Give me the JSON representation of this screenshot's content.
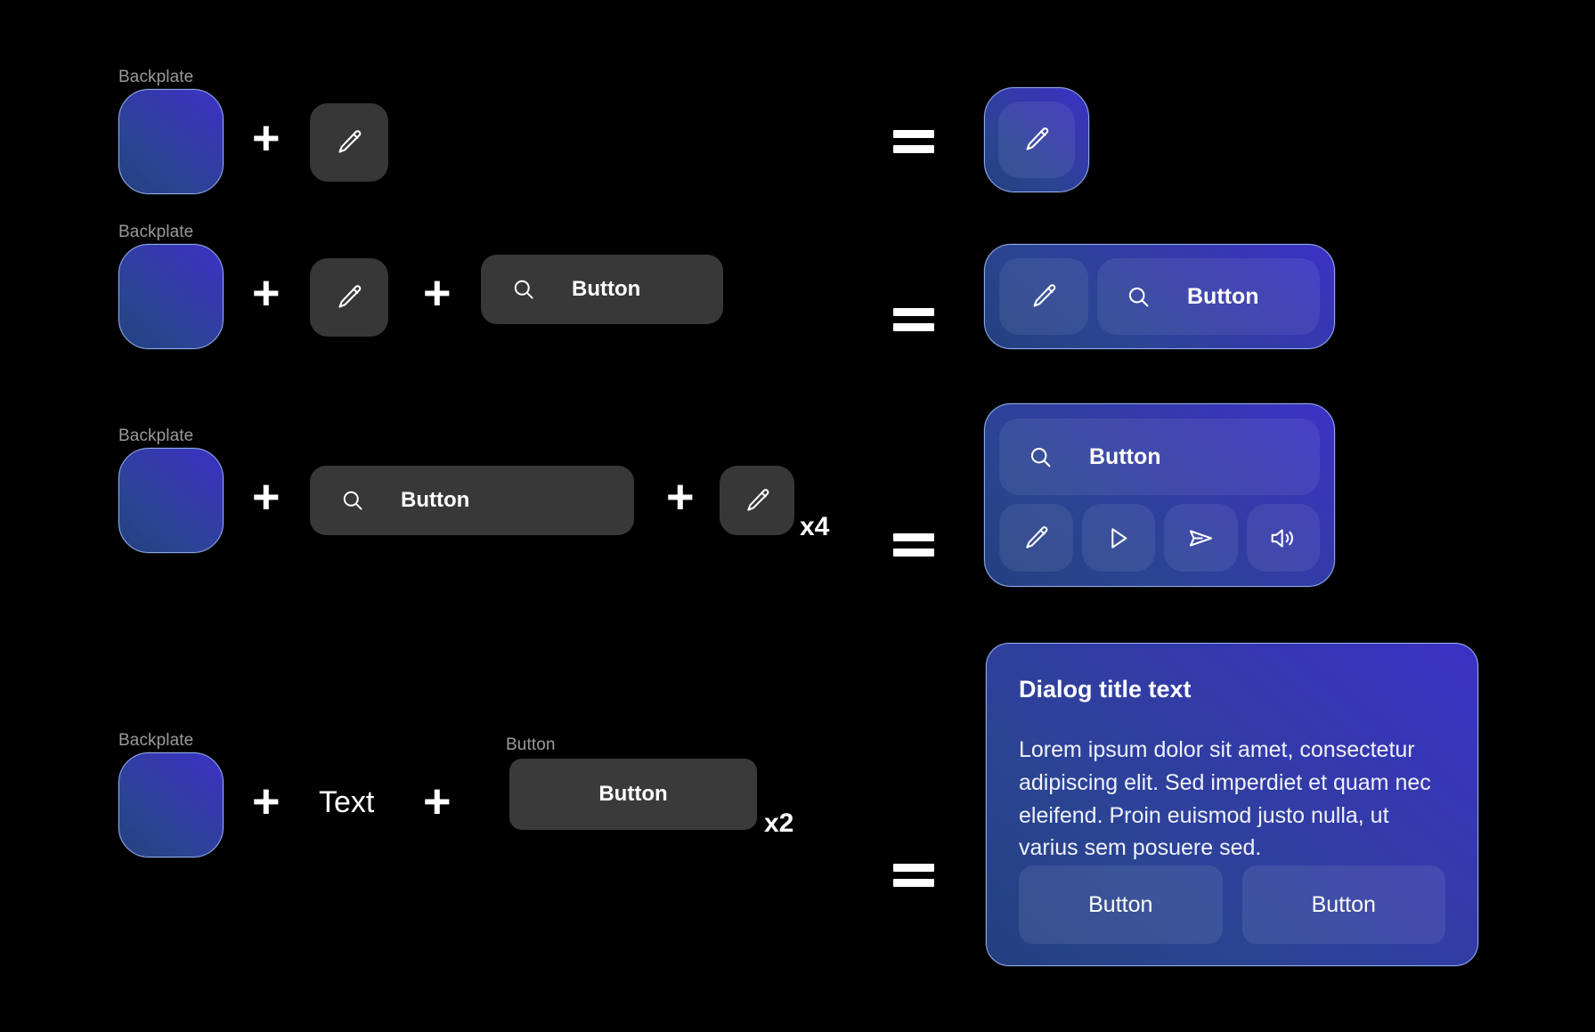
{
  "theme": {
    "background": "#000000",
    "label_color": "#9a9a9a",
    "source_surface": "#373737",
    "backplate_gradient_start": "#24407f",
    "backplate_gradient_end": "#3b32c6",
    "backplate_border": "#8fa8e8",
    "text_on_dark": "#ffffff"
  },
  "operators": {
    "plus": "+",
    "equals": "="
  },
  "rows": [
    {
      "id": "row-icon-button",
      "backplate_label": "Backplate",
      "multiplier": "",
      "source_icon": "pencil-icon",
      "result": {
        "kind": "single-icon-tile",
        "icons": [
          "pencil-icon"
        ]
      }
    },
    {
      "id": "row-icon-plus-pill",
      "backplate_label": "Backplate",
      "multiplier": "",
      "source_icon": "pencil-icon",
      "source_pill": {
        "icon": "search-icon",
        "label": "Button"
      },
      "result": {
        "kind": "icon-and-pill",
        "icon": "pencil-icon",
        "pill_icon": "search-icon",
        "pill_label": "Button"
      }
    },
    {
      "id": "row-pill-plus-icons",
      "backplate_label": "Backplate",
      "multiplier": "x4",
      "source_pill": {
        "icon": "search-icon",
        "label": "Button"
      },
      "source_icon": "pencil-icon",
      "result": {
        "kind": "pill-over-icon-grid",
        "pill_icon": "search-icon",
        "pill_label": "Button",
        "icons": [
          "pencil-icon",
          "play-icon",
          "send-icon",
          "speaker-icon"
        ]
      }
    },
    {
      "id": "row-dialog",
      "backplate_label": "Backplate",
      "text_token": "Text",
      "button_label_caption": "Button",
      "button_label": "Button",
      "multiplier": "x2",
      "result": {
        "kind": "dialog",
        "title": "Dialog title text",
        "body": "Lorem ipsum dolor sit amet, consectetur adipiscing elit. Sed imperdiet et quam nec eleifend. Proin euismod justo nulla, ut varius sem posuere sed.",
        "buttons": [
          "Button",
          "Button"
        ]
      }
    }
  ]
}
